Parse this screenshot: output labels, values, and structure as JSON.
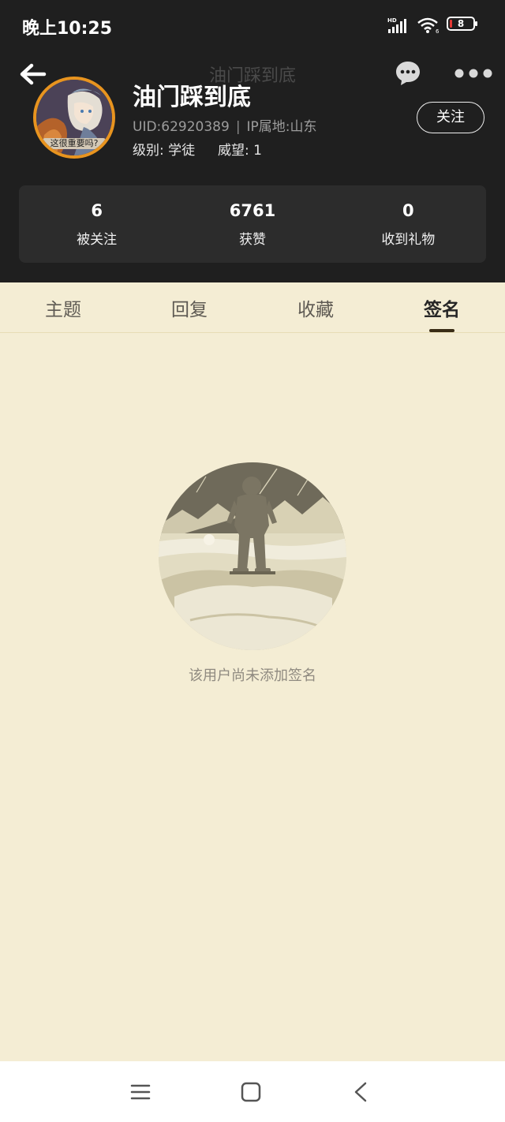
{
  "status_bar": {
    "time": "晚上10:25",
    "battery": "8",
    "icons": [
      "hd-signal-icon",
      "wifi-icon",
      "battery-icon"
    ]
  },
  "header": {
    "faded_title": "油门踩到底",
    "icons": [
      "back-arrow-icon",
      "message-icon",
      "more-icon"
    ],
    "avatar_caption": "这很重要吗?",
    "username": "油门踩到底",
    "uid": "UID:62920389",
    "ip": "IP属地:山东",
    "level_label": "级别:",
    "level_value": "学徒",
    "prestige_label": "威望:",
    "prestige_value": "1",
    "follow_label": "关注"
  },
  "stats": [
    {
      "value": "6",
      "label": "被关注"
    },
    {
      "value": "6761",
      "label": "获赞"
    },
    {
      "value": "0",
      "label": "收到礼物"
    }
  ],
  "tabs": [
    {
      "label": "主题"
    },
    {
      "label": "回复"
    },
    {
      "label": "收藏"
    },
    {
      "label": "签名"
    }
  ],
  "active_tab": "签名",
  "empty_state": {
    "text": "该用户尚未添加签名",
    "icon": "astronaut-landscape-illustration"
  },
  "nav_bar": {
    "icons": [
      "menu-icon",
      "home-icon",
      "back-icon"
    ]
  },
  "colors": {
    "header_bg": "#1f1f1f",
    "page_bg": "#f4edd4",
    "accent_ring": "#e8941f",
    "card_bg": "#2c2c2c"
  }
}
